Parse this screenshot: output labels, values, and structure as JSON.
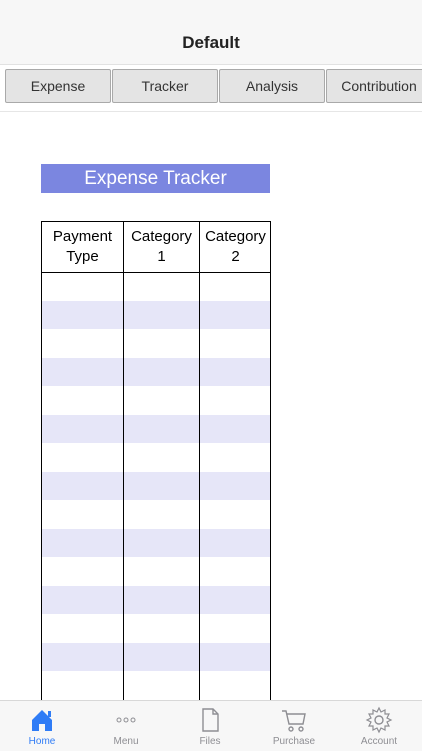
{
  "navbar": {
    "title": "Default"
  },
  "tabs": [
    {
      "label": "Expense"
    },
    {
      "label": "Tracker"
    },
    {
      "label": "Analysis"
    },
    {
      "label": "Contribution"
    }
  ],
  "sheet": {
    "title": "Expense Tracker",
    "title_bg": "#7b86e0",
    "band_color": "#e6e6f8",
    "columns": [
      {
        "line1": "Payment",
        "line2": "Type"
      },
      {
        "line1": "Category",
        "line2": "1"
      },
      {
        "line1": "Category",
        "line2": "2"
      }
    ]
  },
  "tabbar": {
    "accent": "#2f7cf6",
    "items": [
      {
        "label": "Home",
        "icon": "home-icon",
        "active": true
      },
      {
        "label": "Menu",
        "icon": "more-icon"
      },
      {
        "label": "Files",
        "icon": "file-icon"
      },
      {
        "label": "Purchase",
        "icon": "cart-icon"
      },
      {
        "label": "Account",
        "icon": "gear-icon"
      }
    ]
  }
}
